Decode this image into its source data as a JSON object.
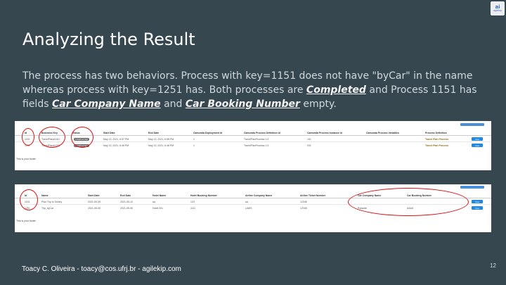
{
  "logo": {
    "mark": "ai",
    "text": "agilekip"
  },
  "slide": {
    "title": "Analyzing the Result",
    "body": {
      "p1": "The process has two behaviors. Process with key=1151  does not have \"byCar\" in the name whereas process with key=1251 has.  Both processes are ",
      "completed": "Completed",
      "p2": " and Process 1151 has fields ",
      "car_company": "Car Company Name",
      "p3": " and ",
      "car_booking": "Car Booking Number",
      "p4": " empty."
    },
    "footer": "Toacy C. Oliveira - toacy@cos.ufrj.br - agilekip.com",
    "page_number": "12"
  },
  "screenshot1": {
    "top_button": "",
    "headers": [
      "Id",
      "Business Key",
      "Status",
      "Start Date",
      "End Date",
      "Camunda Deployment Id",
      "Camunda Process Definition Id",
      "Camunda Process Instance Id",
      "Camunda Process Variables",
      "Process Definition"
    ],
    "rows": [
      {
        "id": "1151",
        "key": "TravelPlan#1151",
        "status": "COMPLETED",
        "start": "May 13, 2021, 6:57 PM",
        "end": "May 13, 2021, 6:58 PM",
        "deploy": "1",
        "procdef": "TravelPlanProcess:1:3",
        "inst": "101",
        "vars": "",
        "def": "Travel Plan Process",
        "view": "View"
      },
      {
        "id": "1251",
        "key": "TravelPlan#1251",
        "status": "COMPLETED",
        "start": "May 13, 2021, 6:45 PM",
        "end": "May 13, 2021, 6:46 PM",
        "deploy": "1",
        "procdef": "TravelPlanProcess:1:3",
        "inst": "201",
        "vars": "",
        "def": "Travel Plan Process",
        "view": "View"
      }
    ],
    "footer": "This is your footer"
  },
  "screenshot2": {
    "top_button": "",
    "headers": [
      "Id",
      "Name",
      "Start Date",
      "End Date",
      "Hotel Name",
      "Hotel Booking Number",
      "Airline Company Name",
      "Airline Ticket Number",
      "Car Company Name",
      "Car Booking Number"
    ],
    "rows": [
      {
        "id": "1151",
        "name": "Plan Trip to Sidney",
        "start": "2021-05-05",
        "end": "2021-05-10",
        "hotel": "aa",
        "hotelnum": "123",
        "airline": "aa",
        "ticket": "12345",
        "carco": "",
        "carnum": "",
        "view": "View"
      },
      {
        "id": "1251",
        "name": "Trip_byCar",
        "start": "2021-05-05",
        "end": "2021-05-06",
        "hotel": "Hotel 001",
        "hotelnum": "1111",
        "airline": "LAMS",
        "ticket": "12345",
        "carco": "Porsche",
        "carnum": "AAAA",
        "view": "View"
      }
    ],
    "footer": "This is your footer"
  },
  "colors": {
    "background": "#37474f",
    "annotation": "#e01010",
    "view_button": "#1e88e5"
  }
}
